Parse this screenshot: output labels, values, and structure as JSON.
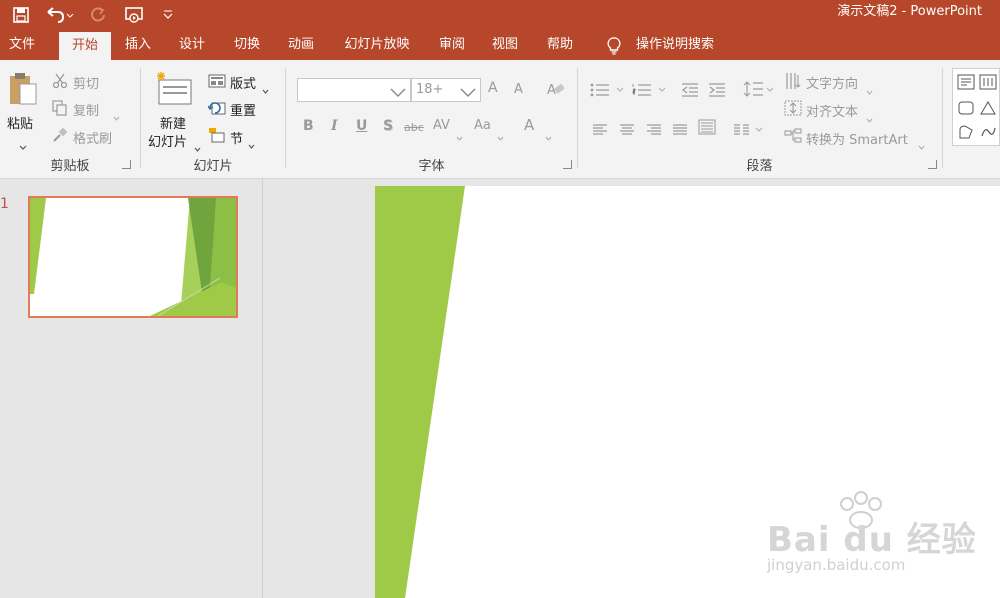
{
  "app": {
    "title": "演示文稿2 - PowerPoint"
  },
  "tabs": [
    {
      "label": "文件"
    },
    {
      "label": "开始"
    },
    {
      "label": "插入"
    },
    {
      "label": "设计"
    },
    {
      "label": "切换"
    },
    {
      "label": "动画"
    },
    {
      "label": "幻灯片放映"
    },
    {
      "label": "审阅"
    },
    {
      "label": "视图"
    },
    {
      "label": "帮助"
    }
  ],
  "tell_me": "操作说明搜索",
  "clipboard": {
    "paste": "粘贴",
    "cut": "剪切",
    "copy": "复制",
    "format_painter": "格式刷",
    "group_label": "剪贴板"
  },
  "slides_group": {
    "new_slide_line1": "新建",
    "new_slide_line2": "幻灯片",
    "layout": "版式",
    "reset": "重置",
    "section": "节",
    "group_label": "幻灯片"
  },
  "font_group": {
    "font_name": "",
    "font_size": "18+",
    "group_label": "字体",
    "bold": "B",
    "italic": "I",
    "underline": "U",
    "shadow": "S",
    "strike": "abc",
    "spacing": "AV",
    "change_case": "Aa",
    "font_color": "A",
    "grow": "A",
    "shrink": "A"
  },
  "paragraph_group": {
    "text_direction": "文字方向",
    "align_text": "对齐文本",
    "convert_smartart": "转换为 SmartArt",
    "group_label": "段落"
  },
  "slide_panel": {
    "slide_number": "1"
  },
  "colors": {
    "accent": "#b7472a",
    "slide_green": "#9fca47",
    "thumb_border": "#e07b58"
  },
  "watermark": {
    "brand_text": "Bai du 经验",
    "url": "jingyan.baidu.com"
  }
}
